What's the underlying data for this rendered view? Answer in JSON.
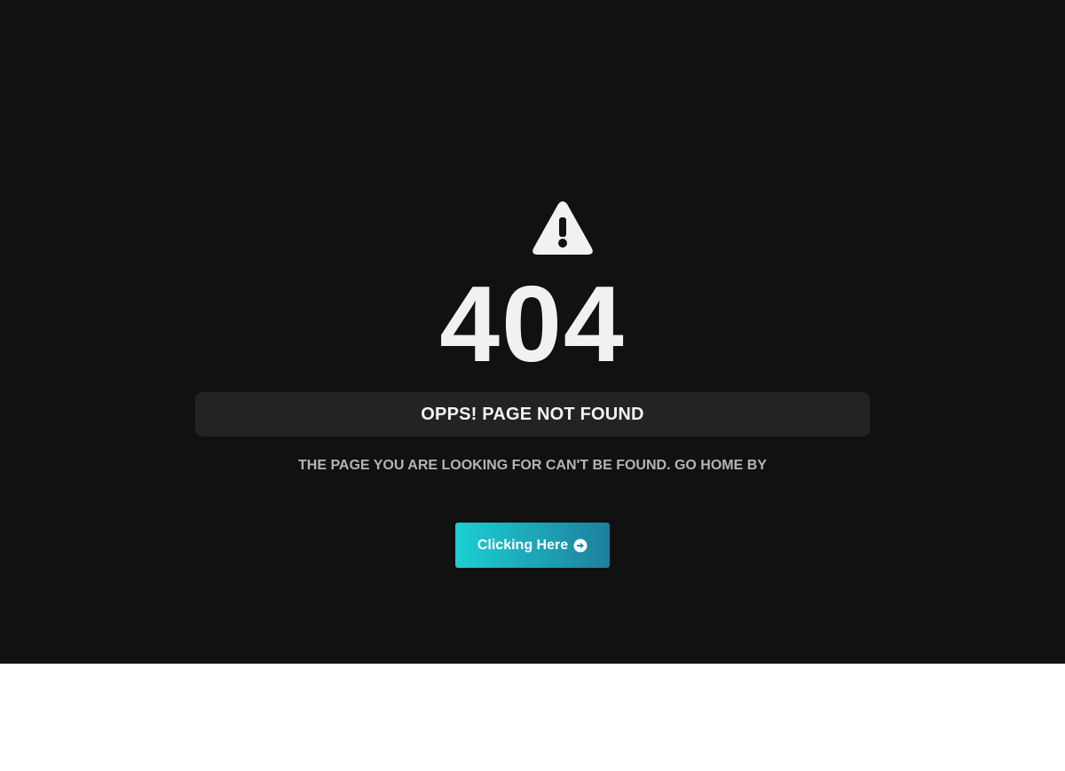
{
  "error": {
    "code": "404",
    "title": "OPPS! PAGE NOT FOUND",
    "description": "THE PAGE YOU ARE LOOKING FOR CAN'T BE FOUND. GO HOME BY",
    "button_label": "Clicking Here",
    "button_icon": "arrow-circle-right-icon",
    "warning_icon": "warning-triangle-icon"
  },
  "colors": {
    "background": "#111111",
    "lower_background": "#ffffff",
    "title_bar": "#232323",
    "text_primary": "#f1f1f1",
    "text_secondary": "#b4b4b4",
    "button_gradient_start": "#1bcfd4",
    "button_gradient_end": "#1e7f9c"
  }
}
